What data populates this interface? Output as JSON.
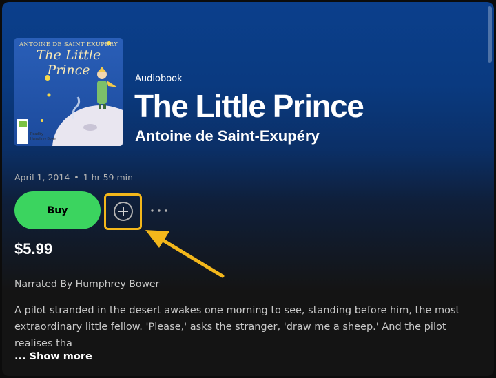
{
  "cover": {
    "author": "ANTOINE DE SAINT EXUPÉRY",
    "title": "The Little Prince",
    "read_by": "Read by",
    "narrator_short": "Humphrey Bower",
    "publisher_logo": "bolinda-logo"
  },
  "header": {
    "type_label": "Audiobook",
    "title": "The Little Prince",
    "author": "Antoine de Saint-Exupéry"
  },
  "meta": {
    "date": "April 1, 2014",
    "separator": "•",
    "duration": "1 hr 59 min"
  },
  "actions": {
    "buy_label": "Buy",
    "add_icon": "plus-circle-icon",
    "more_icon": "ellipsis-icon",
    "price": "$5.99"
  },
  "details": {
    "narrated_by": "Narrated By Humphrey Bower",
    "description": "A pilot stranded in the desert awakes one morning to see, standing before him, the most extraordinary little fellow. 'Please,' asks the stranger, 'draw me a sheep.' And the pilot realises tha",
    "show_more": "... Show more"
  },
  "colors": {
    "accent_green": "#3bd45f",
    "highlight": "#f3b71b",
    "header_blue": "#0b3f8c"
  }
}
